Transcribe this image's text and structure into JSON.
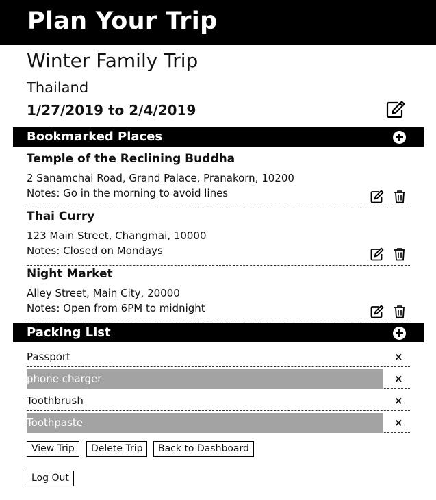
{
  "header": {
    "title": "Plan Your Trip"
  },
  "trip": {
    "name": "Winter Family Trip",
    "country": "Thailand",
    "dates": "1/27/2019 to 2/4/2019"
  },
  "bookmarks": {
    "title": "Bookmarked Places",
    "places": [
      {
        "name": "Temple of the Reclining Buddha",
        "address": "2 Sanamchai Road, Grand Palace, Pranakorn, 10200",
        "notes": "Notes: Go in the morning to avoid lines"
      },
      {
        "name": "Thai Curry",
        "address": "123 Main Street, Changmai, 10000",
        "notes": "Notes: Closed on Mondays"
      },
      {
        "name": "Night Market",
        "address": "Alley Street, Main City, 20000",
        "notes": "Notes: Open from 6PM to midnight"
      }
    ]
  },
  "packing": {
    "title": "Packing List",
    "remove_glyph": "×",
    "items": [
      {
        "label": "Passport",
        "done": false
      },
      {
        "label": "phone charger",
        "done": true
      },
      {
        "label": "Toothbrush",
        "done": false
      },
      {
        "label": "Toothpaste",
        "done": true
      }
    ]
  },
  "actions": {
    "view_trip": "View Trip",
    "delete_trip": "Delete Trip",
    "back_to_dashboard": "Back to Dashboard",
    "log_out": "Log Out"
  },
  "colors": {
    "header_bg": "#000000",
    "done_item_bg": "#a3a3a3"
  }
}
